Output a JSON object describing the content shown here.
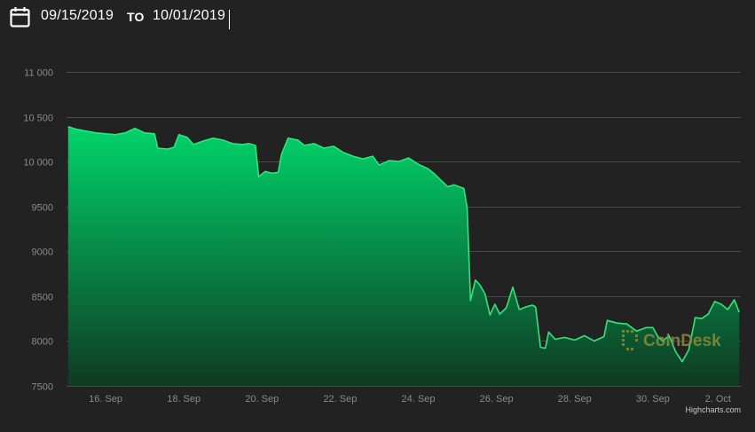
{
  "header": {
    "date_from": "09/15/2019",
    "to_label": "TO",
    "date_to": "10/01/2019",
    "icon": "calendar-icon"
  },
  "watermark": "CoinDesk",
  "credit": "Highcharts.com",
  "colors": {
    "background": "#222222",
    "line": "#2ee67a",
    "area_top": "#00d46a",
    "area_bottom": "#0f3a22",
    "grid": "#4a4a4a",
    "text": "#ffffff"
  },
  "chart_data": {
    "type": "area",
    "title": "",
    "xlabel": "",
    "ylabel": "",
    "x_start": "2019-09-15T00:00",
    "x_end": "2019-10-02T06:00",
    "ylim": [
      7500,
      11000
    ],
    "y_ticks": [
      7500,
      8000,
      8500,
      9000,
      9500,
      10000,
      10500,
      11000
    ],
    "y_tick_labels": [
      "7500",
      "8000",
      "8500",
      "9000",
      "9500",
      "10 000",
      "10 500",
      "11 000"
    ],
    "x_ticks": [
      {
        "date": "2019-09-16",
        "label": "16. Sep"
      },
      {
        "date": "2019-09-18",
        "label": "18. Sep"
      },
      {
        "date": "2019-09-20",
        "label": "20. Sep"
      },
      {
        "date": "2019-09-22",
        "label": "22. Sep"
      },
      {
        "date": "2019-09-24",
        "label": "24. Sep"
      },
      {
        "date": "2019-09-26",
        "label": "26. Sep"
      },
      {
        "date": "2019-09-28",
        "label": "28. Sep"
      },
      {
        "date": "2019-09-30",
        "label": "30. Sep"
      },
      {
        "date": "2019-10-02",
        "label": "2. Oct"
      }
    ],
    "grid": true,
    "legend": "none",
    "series": [
      {
        "points": [
          [
            "2019-09-15T01:00",
            10390
          ],
          [
            "2019-09-15T06:00",
            10360
          ],
          [
            "2019-09-15T12:00",
            10340
          ],
          [
            "2019-09-15T18:00",
            10320
          ],
          [
            "2019-09-16T00:00",
            10310
          ],
          [
            "2019-09-16T06:00",
            10300
          ],
          [
            "2019-09-16T12:00",
            10320
          ],
          [
            "2019-09-16T18:00",
            10370
          ],
          [
            "2019-09-17T00:00",
            10320
          ],
          [
            "2019-09-17T06:00",
            10310
          ],
          [
            "2019-09-17T08:00",
            10150
          ],
          [
            "2019-09-17T14:00",
            10140
          ],
          [
            "2019-09-17T18:00",
            10160
          ],
          [
            "2019-09-17T21:00",
            10300
          ],
          [
            "2019-09-18T02:00",
            10270
          ],
          [
            "2019-09-18T06:00",
            10190
          ],
          [
            "2019-09-18T12:00",
            10230
          ],
          [
            "2019-09-18T18:00",
            10260
          ],
          [
            "2019-09-19T00:00",
            10240
          ],
          [
            "2019-09-19T06:00",
            10200
          ],
          [
            "2019-09-19T12:00",
            10190
          ],
          [
            "2019-09-19T16:00",
            10200
          ],
          [
            "2019-09-19T20:00",
            10180
          ],
          [
            "2019-09-19T22:00",
            9830
          ],
          [
            "2019-09-20T02:00",
            9890
          ],
          [
            "2019-09-20T06:00",
            9870
          ],
          [
            "2019-09-20T10:00",
            9880
          ],
          [
            "2019-09-20T12:00",
            10080
          ],
          [
            "2019-09-20T16:00",
            10260
          ],
          [
            "2019-09-20T22:00",
            10240
          ],
          [
            "2019-09-21T02:00",
            10180
          ],
          [
            "2019-09-21T08:00",
            10200
          ],
          [
            "2019-09-21T14:00",
            10150
          ],
          [
            "2019-09-21T20:00",
            10170
          ],
          [
            "2019-09-22T02:00",
            10100
          ],
          [
            "2019-09-22T08:00",
            10060
          ],
          [
            "2019-09-22T14:00",
            10030
          ],
          [
            "2019-09-22T20:00",
            10060
          ],
          [
            "2019-09-23T00:00",
            9960
          ],
          [
            "2019-09-23T06:00",
            10010
          ],
          [
            "2019-09-23T12:00",
            10000
          ],
          [
            "2019-09-23T18:00",
            10040
          ],
          [
            "2019-09-24T00:00",
            9970
          ],
          [
            "2019-09-24T06:00",
            9920
          ],
          [
            "2019-09-24T10:00",
            9860
          ],
          [
            "2019-09-24T14:00",
            9790
          ],
          [
            "2019-09-24T18:00",
            9720
          ],
          [
            "2019-09-24T22:00",
            9740
          ],
          [
            "2019-09-25T04:00",
            9700
          ],
          [
            "2019-09-25T06:00",
            9480
          ],
          [
            "2019-09-25T08:00",
            8450
          ],
          [
            "2019-09-25T11:00",
            8680
          ],
          [
            "2019-09-25T14:00",
            8620
          ],
          [
            "2019-09-25T17:00",
            8520
          ],
          [
            "2019-09-25T20:00",
            8290
          ],
          [
            "2019-09-25T23:00",
            8410
          ],
          [
            "2019-09-26T02:00",
            8300
          ],
          [
            "2019-09-26T06:00",
            8370
          ],
          [
            "2019-09-26T10:00",
            8600
          ],
          [
            "2019-09-26T14:00",
            8350
          ],
          [
            "2019-09-26T18:00",
            8380
          ],
          [
            "2019-09-26T22:00",
            8400
          ],
          [
            "2019-09-27T00:00",
            8380
          ],
          [
            "2019-09-27T03:00",
            7930
          ],
          [
            "2019-09-27T06:00",
            7920
          ],
          [
            "2019-09-27T08:00",
            8100
          ],
          [
            "2019-09-27T12:00",
            8020
          ],
          [
            "2019-09-27T18:00",
            8040
          ],
          [
            "2019-09-28T00:00",
            8010
          ],
          [
            "2019-09-28T06:00",
            8060
          ],
          [
            "2019-09-28T12:00",
            8000
          ],
          [
            "2019-09-28T18:00",
            8050
          ],
          [
            "2019-09-28T20:00",
            8230
          ],
          [
            "2019-09-29T02:00",
            8200
          ],
          [
            "2019-09-29T08:00",
            8190
          ],
          [
            "2019-09-29T14:00",
            8110
          ],
          [
            "2019-09-29T20:00",
            8150
          ],
          [
            "2019-09-30T00:00",
            8150
          ],
          [
            "2019-09-30T03:00",
            8050
          ],
          [
            "2019-09-30T06:00",
            8000
          ],
          [
            "2019-09-30T10:00",
            8060
          ],
          [
            "2019-09-30T14:00",
            7880
          ],
          [
            "2019-09-30T18:00",
            7770
          ],
          [
            "2019-09-30T22:00",
            7900
          ],
          [
            "2019-10-01T02:00",
            8260
          ],
          [
            "2019-10-01T06:00",
            8250
          ],
          [
            "2019-10-01T10:00",
            8300
          ],
          [
            "2019-10-01T14:00",
            8440
          ],
          [
            "2019-10-01T18:00",
            8410
          ],
          [
            "2019-10-01T22:00",
            8350
          ],
          [
            "2019-10-02T02:00",
            8460
          ],
          [
            "2019-10-02T05:00",
            8320
          ]
        ]
      }
    ]
  }
}
